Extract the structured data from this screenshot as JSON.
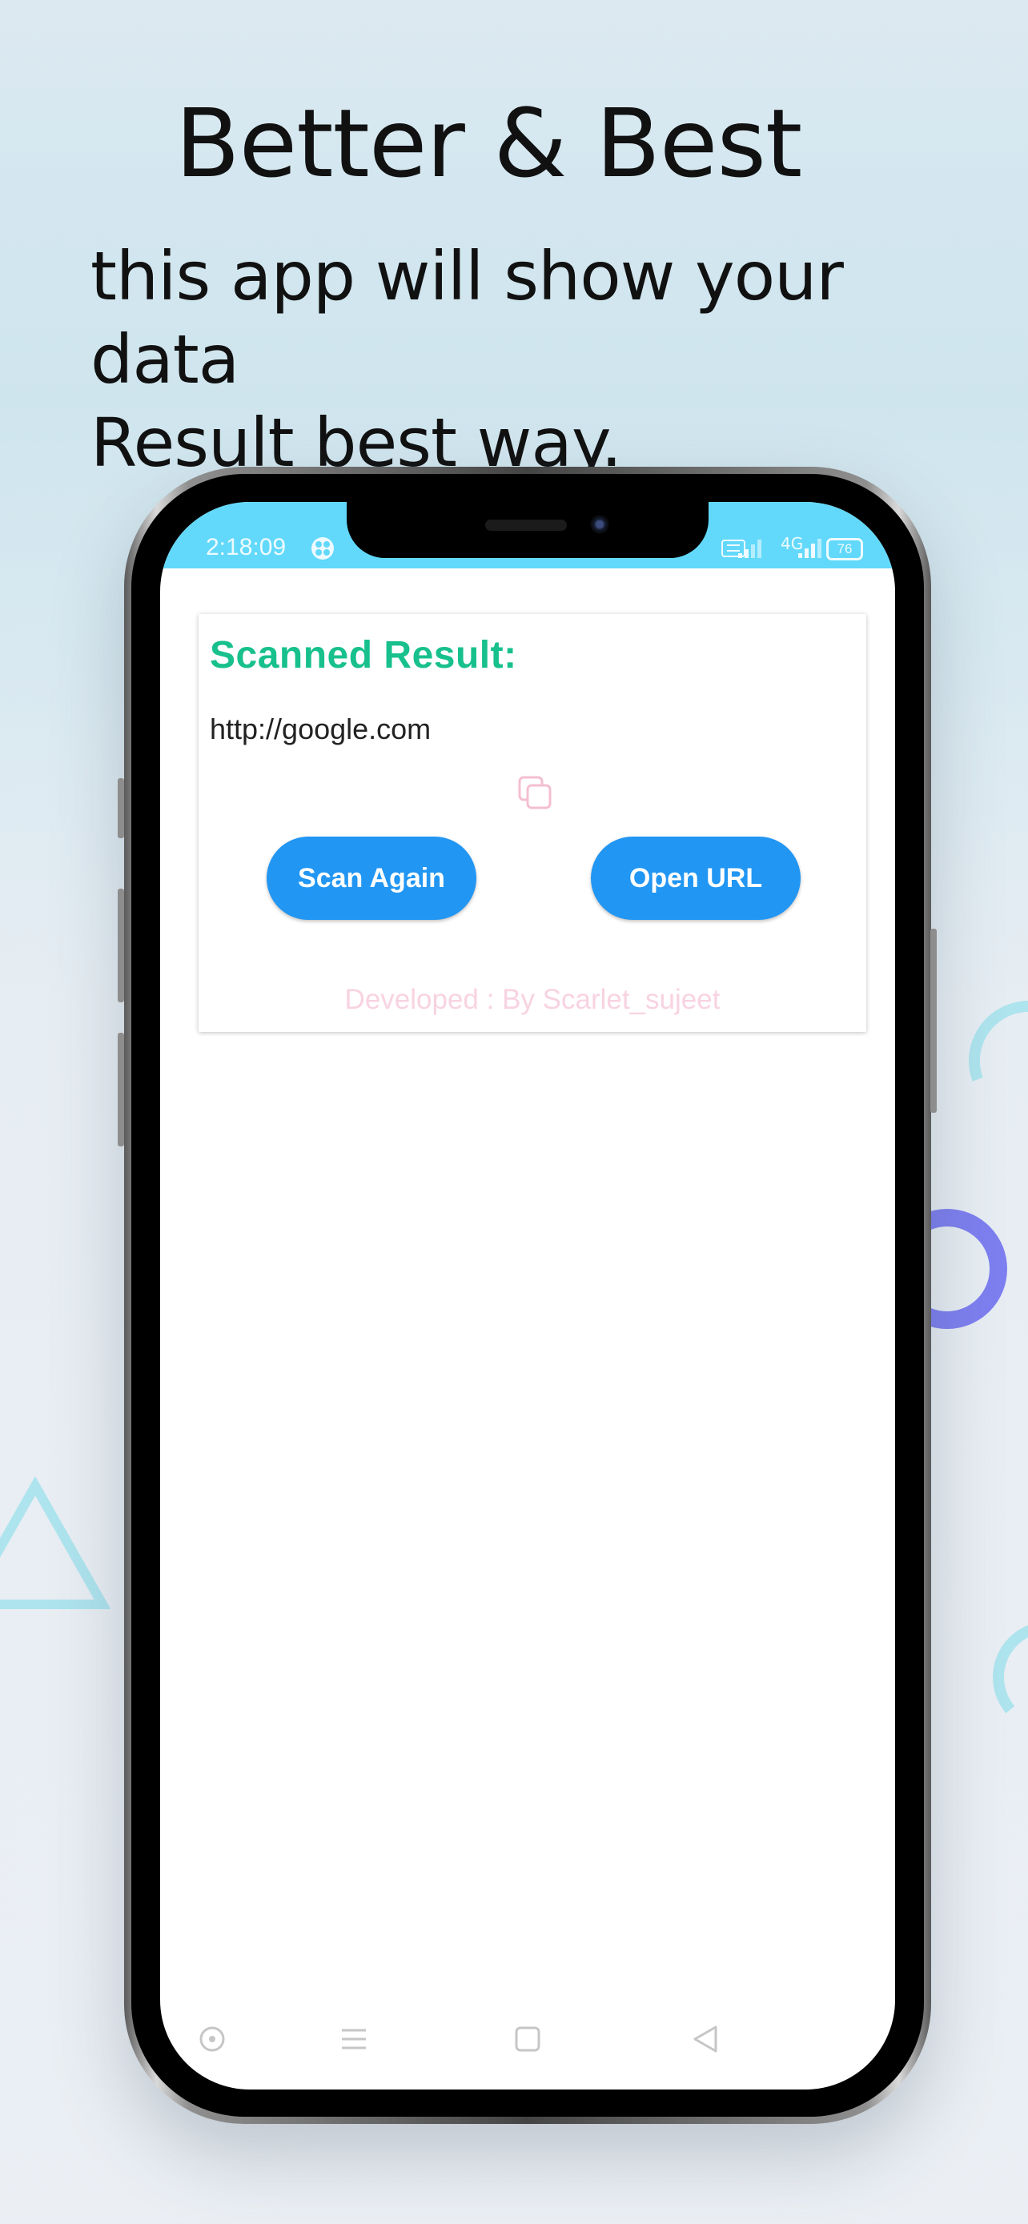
{
  "promo": {
    "headline": "Better & Best",
    "subline_1": "this app will show your data",
    "subline_2": "Result best way."
  },
  "status_bar": {
    "time": "2:18:09",
    "network_label": "4G",
    "battery": "76"
  },
  "result_card": {
    "title": "Scanned Result:",
    "url": "http://google.com",
    "copy_icon": "copy-icon",
    "scan_again_label": "Scan Again",
    "open_url_label": "Open URL",
    "footer": "Developed : By Scarlet_sujeet"
  },
  "navigation": {
    "items": [
      "recent-apps-icon",
      "menu-icon",
      "home-icon",
      "back-icon"
    ]
  },
  "colors": {
    "status_bar": "#62d9fa",
    "title_green": "#17c08c",
    "button_blue": "#2196f3",
    "footer_pink": "#f8d3e2"
  }
}
